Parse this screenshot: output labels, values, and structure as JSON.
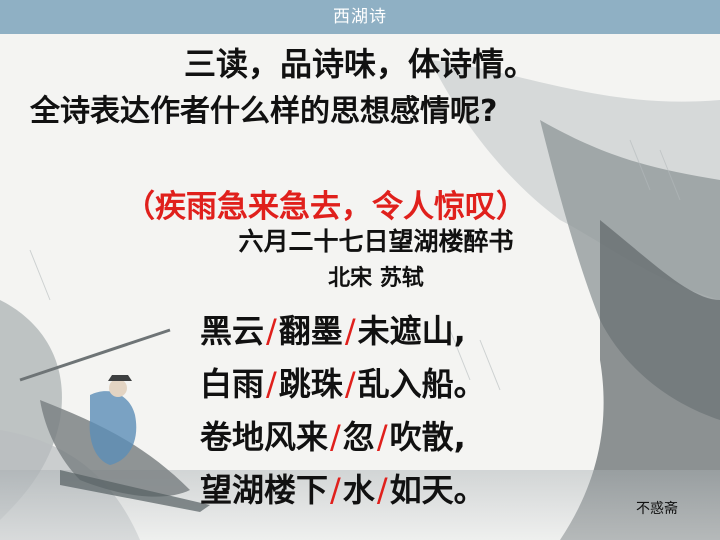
{
  "header": {
    "title": "西湖诗"
  },
  "heading": "三读，品诗味，体诗情。",
  "question": "全诗表达作者什么样的思想感情呢?",
  "answer": "（疾雨急来急去，令人惊叹）",
  "poem": {
    "title": "六月二十七日望湖楼醉书",
    "author": "北宋 苏轼",
    "separator": "/",
    "lines": [
      [
        "黑云",
        "翻墨",
        "未遮山,"
      ],
      [
        "白雨",
        "跳珠",
        "乱入船。"
      ],
      [
        "卷地风来",
        "忽",
        "吹散,"
      ],
      [
        "望湖楼下",
        "水",
        "如天。"
      ]
    ]
  },
  "watermark": "不惑斋",
  "colors": {
    "header_bar": "#8fb0c4",
    "answer": "#e0201c",
    "separator": "#e0201c"
  }
}
